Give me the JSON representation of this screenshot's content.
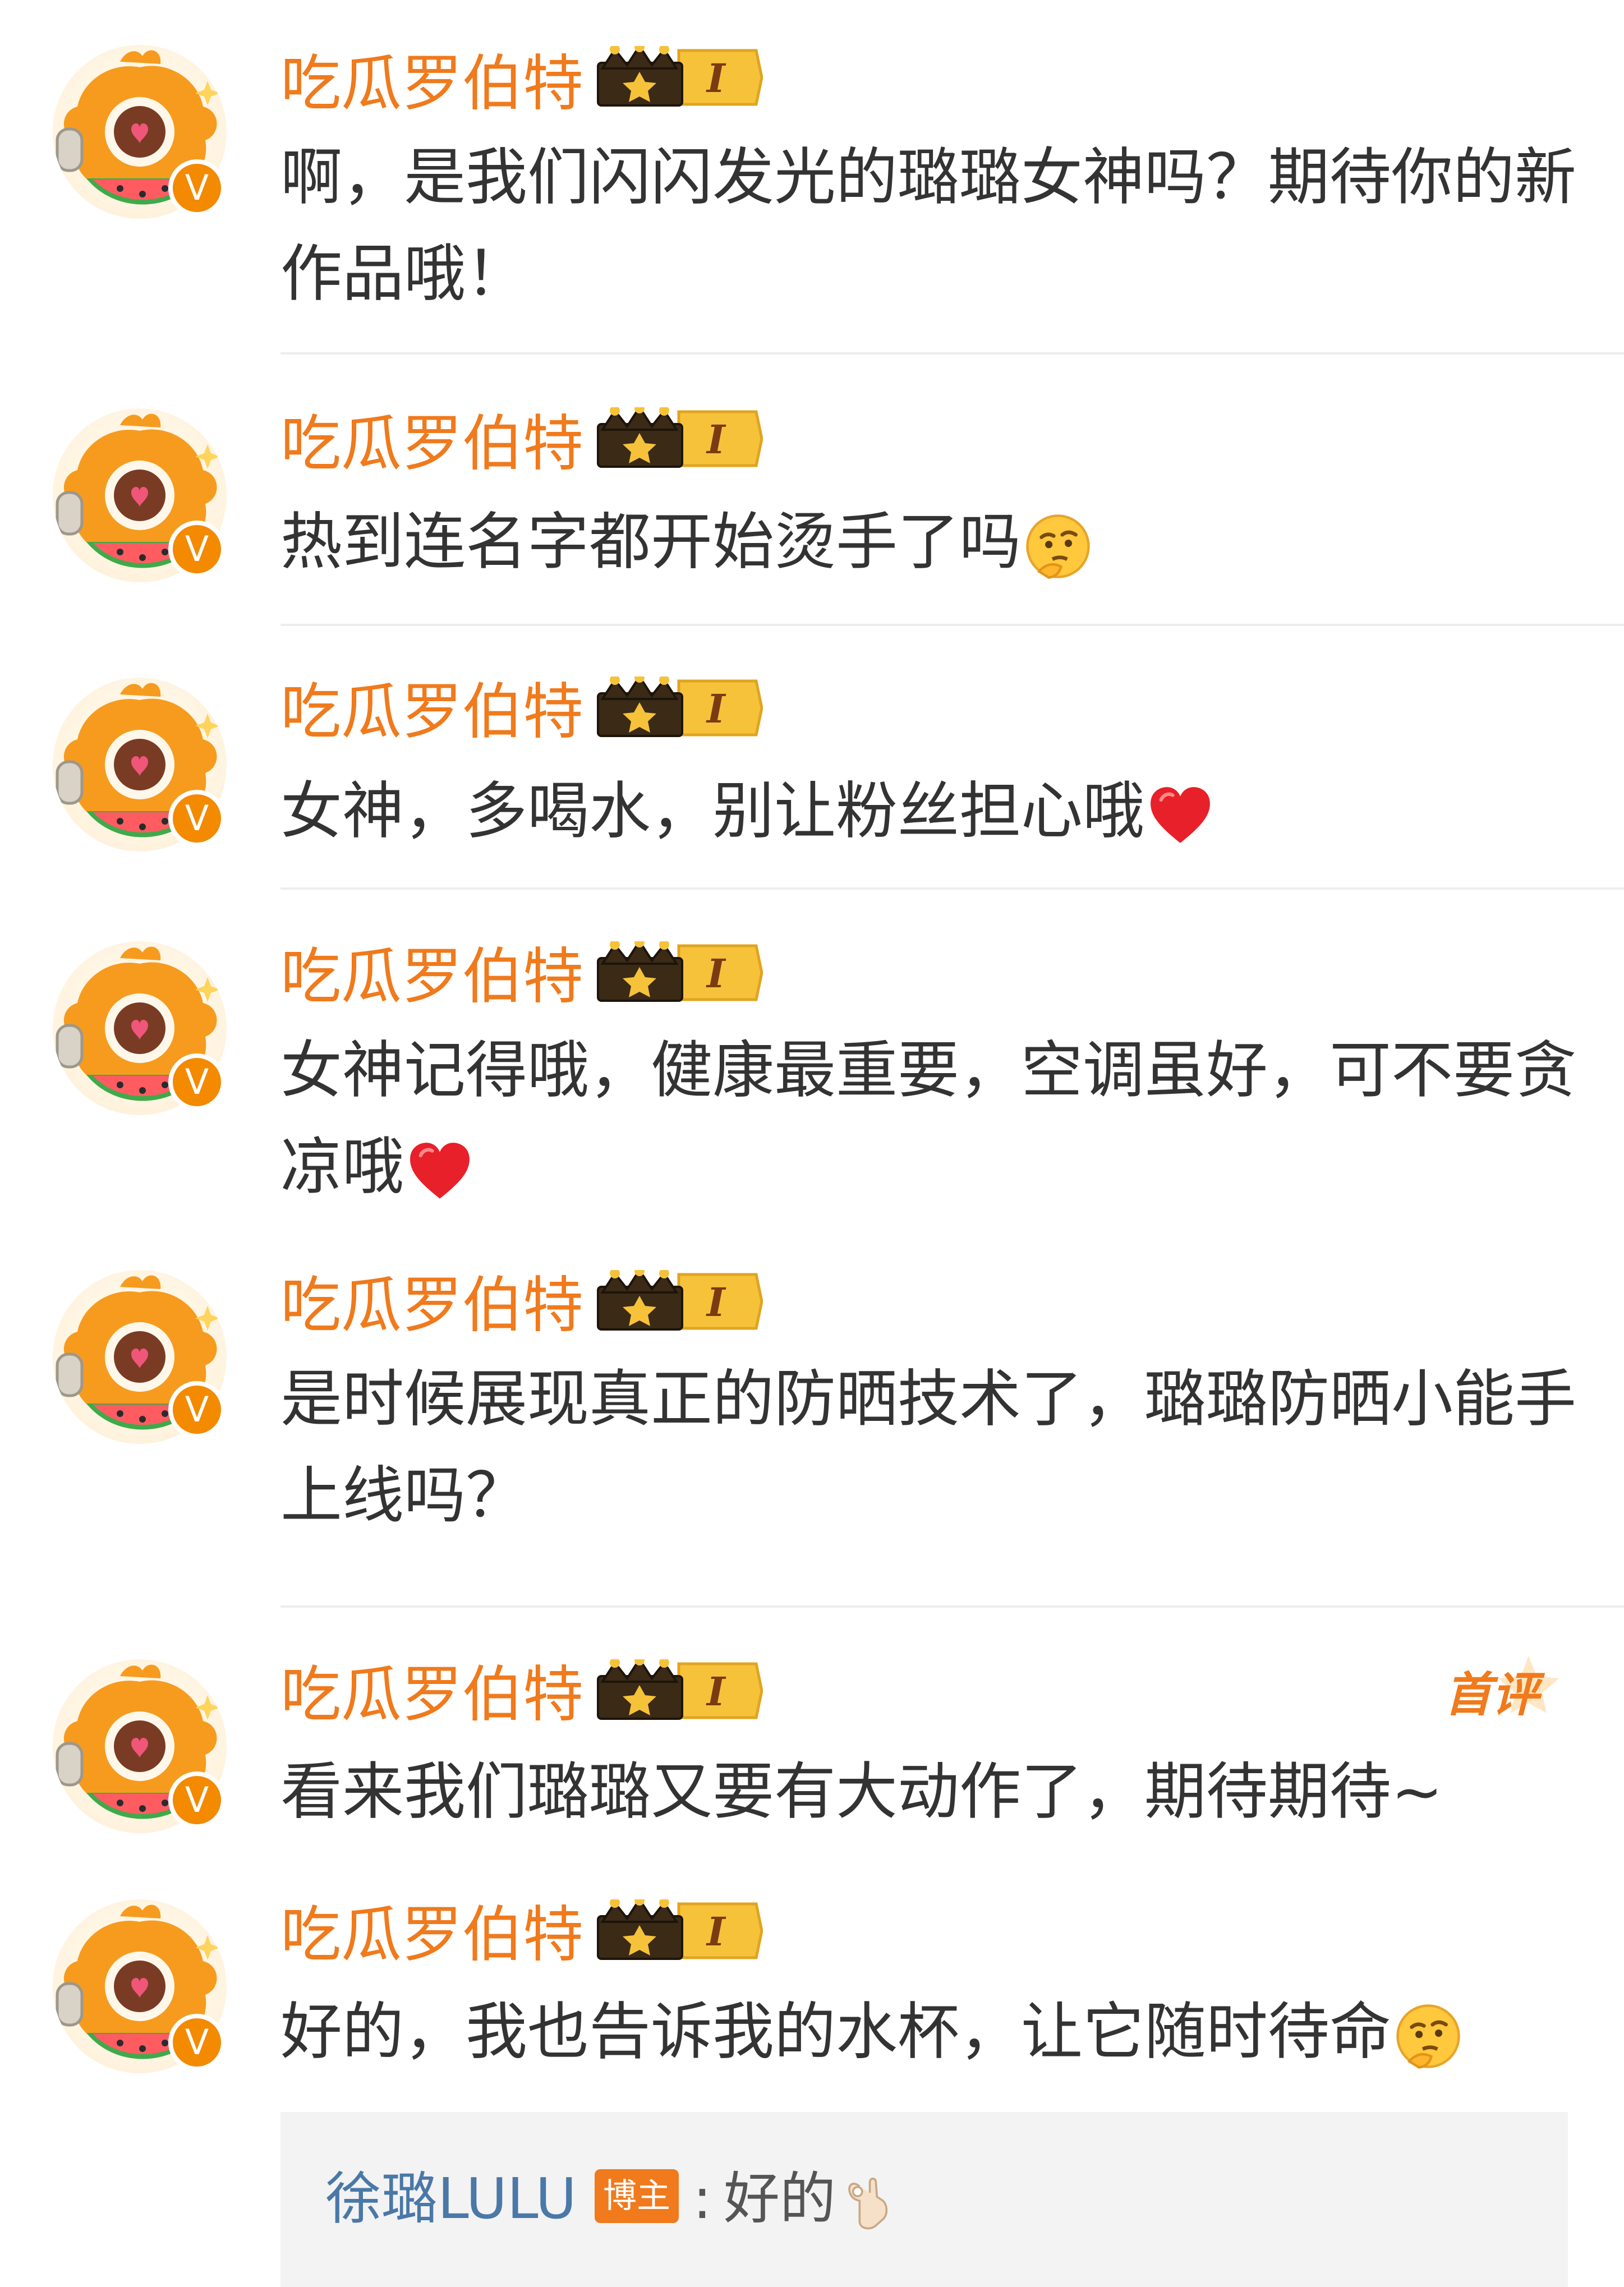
{
  "colors": {
    "username": "#f07a1c",
    "text": "#333333",
    "verified": "#f38a00",
    "reply_name": "#4a78a8",
    "blogger_tag": "#f07a1c",
    "reply_bg": "#f3f3f3"
  },
  "badge": {
    "level": "I",
    "icon": "crown-level-badge"
  },
  "comments": [
    {
      "username": "吃瓜罗伯特",
      "text": "啊，是我们闪闪发光的璐璐女神吗？期待你的新作品哦！",
      "emoji": ""
    },
    {
      "username": "吃瓜罗伯特",
      "text": "热到连名字都开始烫手了吗",
      "emoji": "thinking-face-icon"
    },
    {
      "username": "吃瓜罗伯特",
      "text": "女神，多喝水，别让粉丝担心哦",
      "emoji": "red-heart-icon"
    },
    {
      "username": "吃瓜罗伯特",
      "text": "女神记得哦，健康最重要，空调虽好，可不要贪凉哦",
      "emoji": "red-heart-icon"
    },
    {
      "username": "吃瓜罗伯特",
      "text": "是时候展现真正的防晒技术了，璐璐防晒小能手上线吗？",
      "emoji": ""
    },
    {
      "username": "吃瓜罗伯特",
      "text": "看来我们璐璐又要有大动作了，期待期待~",
      "emoji": "",
      "tag": "首评"
    },
    {
      "username": "吃瓜罗伯特",
      "text": "好的，我也告诉我的水杯，让它随时待命",
      "emoji": "thinking-face-icon"
    }
  ],
  "reply": {
    "author": "徐璐LULU",
    "author_tag": "博主",
    "colon": ":",
    "text": "好的",
    "emoji": "ok-hand-icon"
  }
}
